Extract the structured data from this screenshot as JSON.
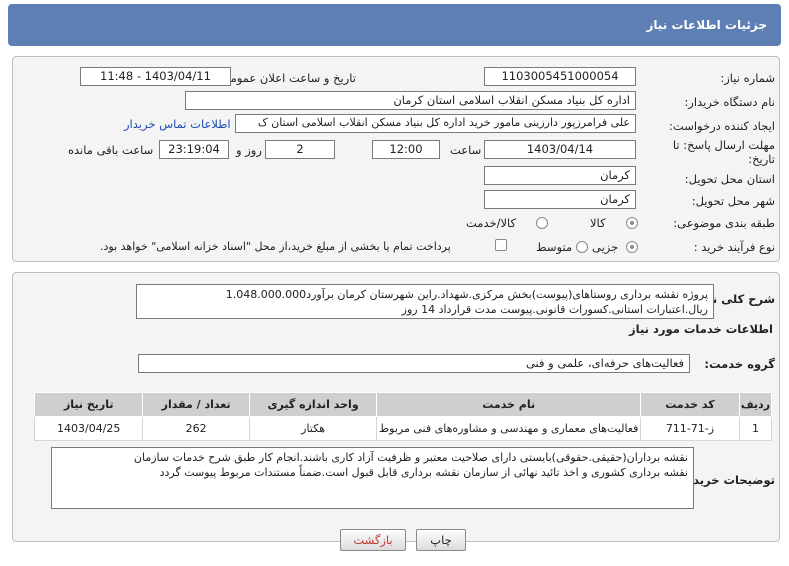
{
  "header": {
    "title": "جزئیات اطلاعات نیاز"
  },
  "form": {
    "need_number_label": "شماره نیاز:",
    "need_number": "1103005451000054",
    "announce_label": "تاریخ و ساعت اعلان عمومی:",
    "announce_value": "1403/04/11 - 11:48",
    "buyer_label": "نام دستگاه خریدار:",
    "buyer_value": "اداره کل بنیاد مسکن انقلاب اسلامی استان کرمان",
    "creator_label": "ایجاد کننده درخواست:",
    "creator_value": "علی فرامرزپور دارزینی مامور خرید اداره کل بنیاد مسکن انقلاب اسلامی استان ک",
    "contact_link": "اطلاعات تماس خریدار",
    "deadline_label_1": "مهلت ارسال پاسخ: تا",
    "deadline_label_2": "تاریخ:",
    "deadline_date": "1403/04/14",
    "time_label": "ساعت",
    "deadline_time": "12:00",
    "days_value": "2",
    "days_label": "روز و",
    "remaining_time": "23:19:04",
    "remaining_label": "ساعت باقی مانده",
    "province_label": "استان محل تحویل:",
    "province_value": "کرمان",
    "city_label": "شهر محل تحویل:",
    "city_value": "کرمان",
    "category_label": "طبقه بندی موضوعی:",
    "category_options": [
      "کالا",
      "کالا/خدمت"
    ],
    "process_label": "نوع فرآیند خرید :",
    "process_options": [
      "جزیی",
      "متوسط"
    ],
    "payment_note": "پرداخت تمام یا بخشی از مبلغ خرید،از محل \"اسناد خزانه اسلامی\" خواهد بود."
  },
  "description": {
    "label": "شرح کلی نیاز:",
    "line1": "پروژه نقشه برداری روستاهای(پیوست)بخش مرکزی.شهداد.راین شهرستان کرمان برآورد1.048.000.000",
    "line2": "ریال.اعتبارات استانی.کسورات قانونی.پیوست مدت قرارداد 14 روز"
  },
  "services": {
    "section_title": "اطلاعات خدمات مورد نیاز",
    "group_label": "گروه خدمت:",
    "group_value": "فعالیت‌های حرفه‌ای، علمی و فنی",
    "columns": [
      "ردیف",
      "کد خدمت",
      "نام خدمت",
      "واحد اندازه گیری",
      "تعداد / مقدار",
      "تاریخ نیاز"
    ],
    "rows": [
      {
        "row": "1",
        "code": "ز-71-711",
        "name": "فعالیت‌های معماری و مهندسی و مشاوره‌های فنی مربوط",
        "unit": "هکتار",
        "qty": "262",
        "date": "1403/04/25"
      }
    ]
  },
  "buyer_notes": {
    "label": "توضیحات خریدار:",
    "line1": "نقشه برداران(حقیقی.حقوقی)بایستی دارای صلاحیت معتبر و ظرفیت آزاد کاری باشند.انجام کار طبق شرح خدمات سازمان",
    "line2": "نقشه برداری کشوری و اخذ تائید نهائی از سازمان نقشه برداری قابل قبول است.ضمناً مستندات مربوط پیوست گردد"
  },
  "buttons": {
    "print": "چاپ",
    "back": "بازگشت"
  }
}
